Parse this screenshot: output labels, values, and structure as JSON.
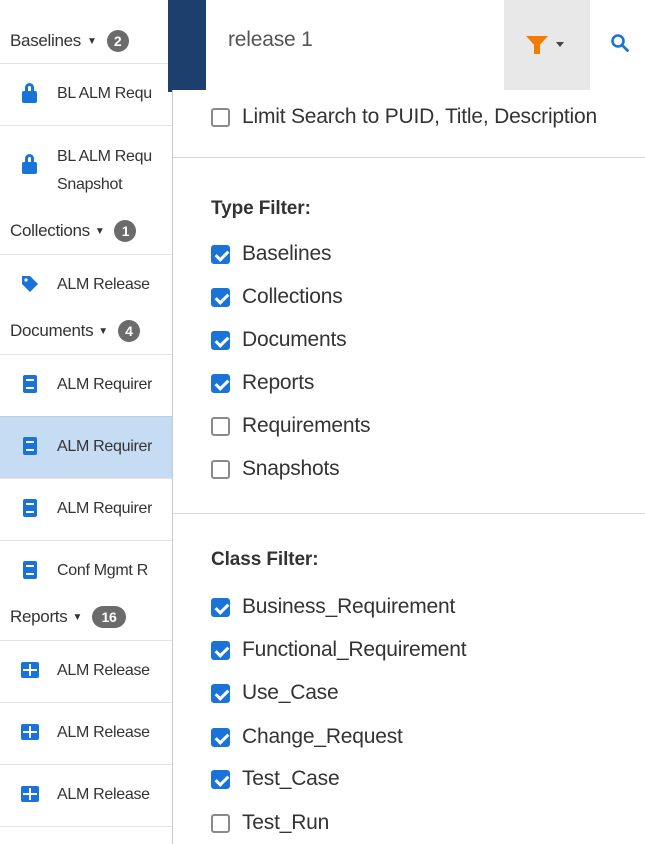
{
  "search": {
    "value": "release 1"
  },
  "sidebar": {
    "groups": [
      {
        "name": "Baselines",
        "count": "2"
      },
      {
        "name": "Collections",
        "count": "1"
      },
      {
        "name": "Documents",
        "count": "4"
      },
      {
        "name": "Reports",
        "count": "16"
      }
    ],
    "items": [
      {
        "label": "BL ALM Requ",
        "label2": ""
      },
      {
        "label": "BL ALM Requ",
        "label2": "Snapshot"
      },
      {
        "label": "ALM Release"
      },
      {
        "label": "ALM Requirer"
      },
      {
        "label": "ALM Requirer"
      },
      {
        "label": "ALM Requirer"
      },
      {
        "label": "Conf Mgmt  R"
      },
      {
        "label": "ALM Release"
      },
      {
        "label": "ALM Release"
      },
      {
        "label": "ALM Release"
      }
    ]
  },
  "filter_panel": {
    "limit_search_label": "Limit Search to PUID, Title, Description",
    "limit_search_checked": false,
    "type_filter_title": "Type Filter:",
    "type_filters": [
      {
        "label": "Baselines",
        "checked": true
      },
      {
        "label": "Collections",
        "checked": true
      },
      {
        "label": "Documents",
        "checked": true
      },
      {
        "label": "Reports",
        "checked": true
      },
      {
        "label": "Requirements",
        "checked": false
      },
      {
        "label": "Snapshots",
        "checked": false
      }
    ],
    "class_filter_title": "Class Filter:",
    "class_filters": [
      {
        "label": "Business_Requirement",
        "checked": true
      },
      {
        "label": "Functional_Requirement",
        "checked": true
      },
      {
        "label": "Use_Case",
        "checked": true
      },
      {
        "label": "Change_Request",
        "checked": true
      },
      {
        "label": "Test_Case",
        "checked": true
      },
      {
        "label": "Test_Run",
        "checked": false
      }
    ]
  },
  "colors": {
    "accent": "#1a73d9",
    "filter_icon": "#f57c00",
    "selected_row": "#c5dcf3",
    "header_dark": "#1c3f6e"
  }
}
